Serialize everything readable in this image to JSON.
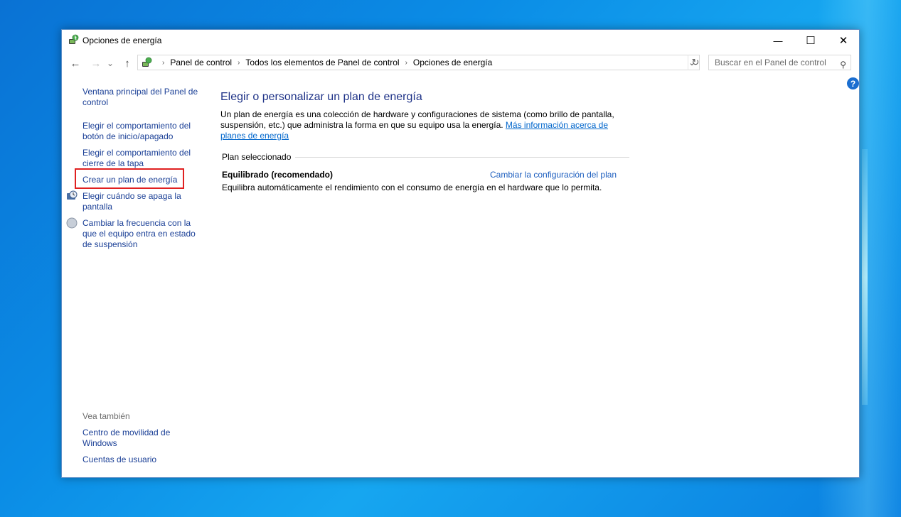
{
  "window": {
    "title": "Opciones de energía",
    "controls": {
      "minimize": "—",
      "maximize": "☐",
      "close": "✕"
    }
  },
  "nav": {
    "back": "←",
    "forward": "→",
    "recent": "⌄",
    "up": "↑"
  },
  "address": {
    "crumbs": [
      "Panel de control",
      "Todos los elementos de Panel de control",
      "Opciones de energía"
    ],
    "separator": "›",
    "dropdown": "⌄",
    "refresh": "↻"
  },
  "search": {
    "placeholder": "Buscar en el Panel de control",
    "icon": "⚲"
  },
  "help": {
    "label": "?"
  },
  "sidebar": {
    "items": [
      {
        "label": "Ventana principal del Panel de control"
      },
      {
        "label": "Elegir el comportamiento del botón de inicio/apagado"
      },
      {
        "label": "Elegir el comportamiento del cierre de la tapa"
      },
      {
        "label": "Crear un plan de energía"
      },
      {
        "label": "Elegir cuándo se apaga la pantalla"
      },
      {
        "label": "Cambiar la frecuencia con la que el equipo entra en estado de suspensión"
      }
    ],
    "see_also_label": "Vea también",
    "see_also": [
      {
        "label": "Centro de movilidad de Windows"
      },
      {
        "label": "Cuentas de usuario"
      }
    ]
  },
  "main": {
    "heading": "Elegir o personalizar un plan de energía",
    "description": "Un plan de energía es una colección de hardware y configuraciones de sistema (como brillo de pantalla, suspensión, etc.) que administra la forma en que su equipo usa la energía.",
    "more_info_link": "Más información acerca de planes de energía",
    "group_label": "Plan seleccionado",
    "plan": {
      "name": "Equilibrado (recomendado)",
      "change_link": "Cambiar la configuración del plan",
      "description": "Equilibra automáticamente el rendimiento con el consumo de energía en el hardware que lo permita."
    }
  }
}
